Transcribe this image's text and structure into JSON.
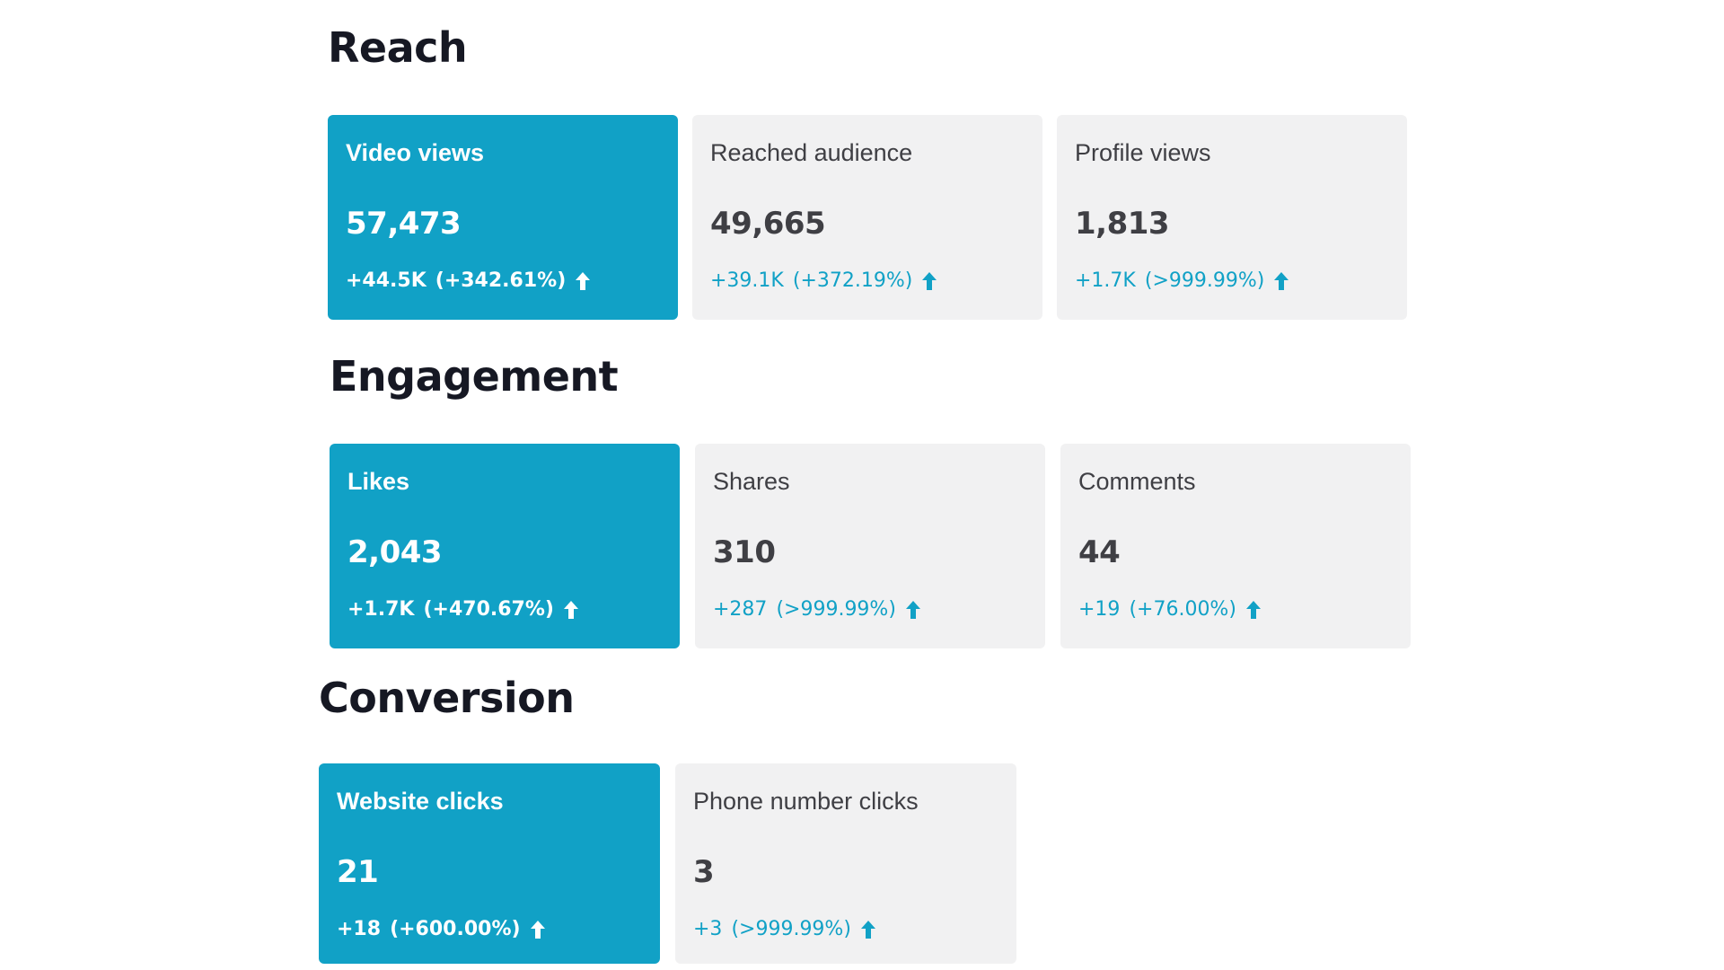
{
  "colors": {
    "accent": "#11a1c6",
    "card_bg": "#f1f1f2",
    "title": "#161823"
  },
  "sections": {
    "reach": {
      "title": "Reach",
      "cards": [
        {
          "label": "Video views",
          "value": "57,473",
          "change": "+44.5K",
          "percent": "(+342.61%)",
          "icon": "arrow-up-icon"
        },
        {
          "label": "Reached audience",
          "value": "49,665",
          "change": "+39.1K",
          "percent": "(+372.19%)",
          "icon": "arrow-up-icon"
        },
        {
          "label": "Profile views",
          "value": "1,813",
          "change": "+1.7K",
          "percent": "(>999.99%)",
          "icon": "arrow-up-icon"
        }
      ]
    },
    "engagement": {
      "title": "Engagement",
      "cards": [
        {
          "label": "Likes",
          "value": "2,043",
          "change": "+1.7K",
          "percent": "(+470.67%)",
          "icon": "arrow-up-icon"
        },
        {
          "label": "Shares",
          "value": "310",
          "change": "+287",
          "percent": "(>999.99%)",
          "icon": "arrow-up-icon"
        },
        {
          "label": "Comments",
          "value": "44",
          "change": "+19",
          "percent": "(+76.00%)",
          "icon": "arrow-up-icon"
        }
      ]
    },
    "conversion": {
      "title": "Conversion",
      "cards": [
        {
          "label": "Website clicks",
          "value": "21",
          "change": "+18",
          "percent": "(+600.00%)",
          "icon": "arrow-up-icon"
        },
        {
          "label": "Phone number clicks",
          "value": "3",
          "change": "+3",
          "percent": "(>999.99%)",
          "icon": "arrow-up-icon"
        }
      ]
    }
  }
}
